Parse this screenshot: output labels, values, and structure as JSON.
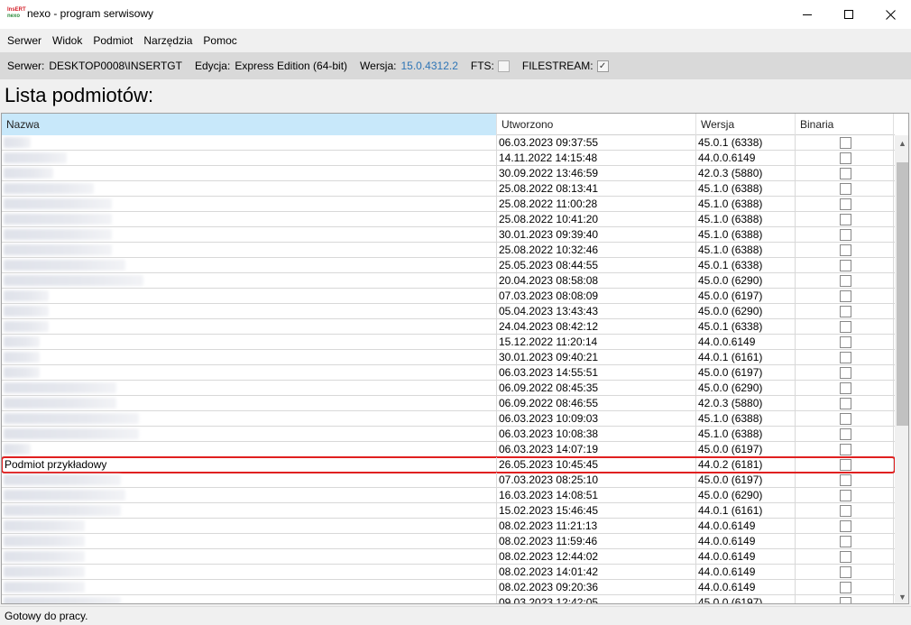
{
  "window": {
    "title": "nexo - program serwisowy",
    "icon_line1": "InsERT",
    "icon_line2": "nexo"
  },
  "menu": [
    "Serwer",
    "Widok",
    "Podmiot",
    "Narzędzia",
    "Pomoc"
  ],
  "info": {
    "server_label": "Serwer:",
    "server_value": "DESKTOP0008\\INSERTGT",
    "edition_label": "Edycja:",
    "edition_value": "Express Edition (64-bit)",
    "version_label": "Wersja:",
    "version_value": "15.0.4312.2",
    "version_color": "#2e75b6",
    "fts_label": "FTS:",
    "fts_checked": false,
    "filestream_label": "FILESTREAM:",
    "filestream_checked": true,
    "check_mark": "✓"
  },
  "list_title": "Lista podmiotów:",
  "columns": [
    "Nazwa",
    "Utworzono",
    "Wersja",
    "Binaria"
  ],
  "rows": [
    {
      "name": "",
      "blur": 30,
      "created": "06.03.2023 09:37:55",
      "version": "45.0.1 (6338)"
    },
    {
      "name": "",
      "blur": 70,
      "created": "14.11.2022 14:15:48",
      "version": "44.0.0.6149"
    },
    {
      "name": "",
      "blur": 55,
      "created": "30.09.2022 13:46:59",
      "version": "42.0.3 (5880)"
    },
    {
      "name": "",
      "blur": 100,
      "created": "25.08.2022 08:13:41",
      "version": "45.1.0 (6388)"
    },
    {
      "name": "",
      "blur": 120,
      "created": "25.08.2022 11:00:28",
      "version": "45.1.0 (6388)"
    },
    {
      "name": "",
      "blur": 120,
      "created": "25.08.2022 10:41:20",
      "version": "45.1.0 (6388)"
    },
    {
      "name": "",
      "blur": 120,
      "created": "30.01.2023 09:39:40",
      "version": "45.1.0 (6388)"
    },
    {
      "name": "",
      "blur": 120,
      "created": "25.08.2022 10:32:46",
      "version": "45.1.0 (6388)"
    },
    {
      "name": "",
      "blur": 135,
      "created": "25.05.2023 08:44:55",
      "version": "45.0.1 (6338)"
    },
    {
      "name": "",
      "blur": 155,
      "created": "20.04.2023 08:58:08",
      "version": "45.0.0 (6290)"
    },
    {
      "name": "",
      "blur": 50,
      "created": "07.03.2023 08:08:09",
      "version": "45.0.0 (6197)"
    },
    {
      "name": "",
      "blur": 50,
      "created": "05.04.2023 13:43:43",
      "version": "45.0.0 (6290)"
    },
    {
      "name": "",
      "blur": 50,
      "created": "24.04.2023 08:42:12",
      "version": "45.0.1 (6338)"
    },
    {
      "name": "",
      "blur": 40,
      "created": "15.12.2022 11:20:14",
      "version": "44.0.0.6149"
    },
    {
      "name": "",
      "blur": 40,
      "created": "30.01.2023 09:40:21",
      "version": "44.0.1 (6161)"
    },
    {
      "name": "",
      "blur": 40,
      "created": "06.03.2023 14:55:51",
      "version": "45.0.0 (6197)"
    },
    {
      "name": "",
      "blur": 125,
      "created": "06.09.2022 08:45:35",
      "version": "45.0.0 (6290)"
    },
    {
      "name": "",
      "blur": 125,
      "created": "06.09.2022 08:46:55",
      "version": "42.0.3 (5880)"
    },
    {
      "name": "",
      "blur": 150,
      "created": "06.03.2023 10:09:03",
      "version": "45.1.0 (6388)"
    },
    {
      "name": "",
      "blur": 150,
      "created": "06.03.2023 10:08:38",
      "version": "45.1.0 (6388)"
    },
    {
      "name": "",
      "blur": 30,
      "created": "06.03.2023 14:07:19",
      "version": "45.0.0 (6197)"
    },
    {
      "name": "Podmiot przykładowy",
      "blur": 0,
      "created": "26.05.2023 10:45:45",
      "version": "44.0.2 (6181)",
      "highlight": true
    },
    {
      "name": "",
      "blur": 130,
      "created": "07.03.2023 08:25:10",
      "version": "45.0.0 (6197)"
    },
    {
      "name": "",
      "blur": 135,
      "created": "16.03.2023 14:08:51",
      "version": "45.0.0 (6290)"
    },
    {
      "name": "",
      "blur": 130,
      "created": "15.02.2023 15:46:45",
      "version": "44.0.1 (6161)"
    },
    {
      "name": "",
      "blur": 90,
      "created": "08.02.2023 11:21:13",
      "version": "44.0.0.6149"
    },
    {
      "name": "",
      "blur": 90,
      "created": "08.02.2023 11:59:46",
      "version": "44.0.0.6149"
    },
    {
      "name": "",
      "blur": 90,
      "created": "08.02.2023 12:44:02",
      "version": "44.0.0.6149"
    },
    {
      "name": "",
      "blur": 90,
      "created": "08.02.2023 14:01:42",
      "version": "44.0.0.6149"
    },
    {
      "name": "",
      "blur": 90,
      "created": "08.02.2023 09:20:36",
      "version": "44.0.0.6149"
    },
    {
      "name": "",
      "blur": 130,
      "created": "09.03.2023 12:42:05",
      "version": "45.0.0 (6197)"
    }
  ],
  "status": "Gotowy do pracy.",
  "highlight_color": "#e02020"
}
